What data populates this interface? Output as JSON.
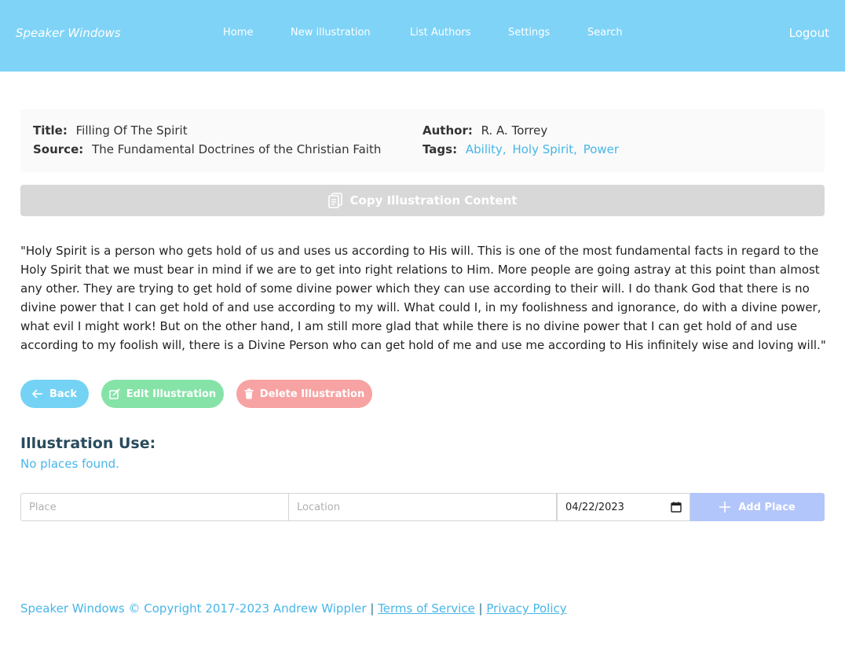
{
  "nav": {
    "brand": "Speaker Windows",
    "links": [
      "Home",
      "New illustration",
      "List Authors",
      "Settings",
      "Search"
    ],
    "logout": "Logout"
  },
  "illustration": {
    "title_label": "Title:",
    "title": "Filling Of The Spirit",
    "source_label": "Source:",
    "source": "The Fundamental Doctrines of the Christian Faith",
    "author_label": "Author:",
    "author": "R. A. Torrey",
    "tags_label": "Tags:",
    "tags": [
      "Ability,",
      "Holy Spirit,",
      "Power"
    ],
    "content": "\"Holy Spirit is a person who gets hold of us and uses us according to His will. This is one of the most fundamental facts in regard to the Holy Spirit that we must bear in mind if we are to get into right relations to Him. More people are going astray at this point than almost any other. They are trying to get hold of some divine power which they can use according to their will. I do thank God that there is no divine power that I can get hold of and use according to my will. What could I, in my foolishness and ignorance, do with a divine power, what evil I might work! But on the other hand, I am still more glad that while there is no divine power that I can get hold of and use according to my foolish will, there is a Divine Person who can get hold of me and use me according to His infinitely wise and loving will.\""
  },
  "actions": {
    "copy": "Copy Illustration Content",
    "back": "Back",
    "edit": "Edit Illustration",
    "delete": "Delete Illustration"
  },
  "use": {
    "title": "Illustration Use:",
    "empty": "No places found.",
    "place_placeholder": "Place",
    "location_placeholder": "Location",
    "date_value": "04/22/2023",
    "add": "Add Place"
  },
  "footer": {
    "text": "Speaker Windows © Copyright 2017-2023 Andrew Wippler",
    "sep": "|",
    "terms": "Terms of Service",
    "privacy": "Privacy Policy"
  },
  "colors": {
    "navbar": "#7fd3f7",
    "accent": "#47b6e8",
    "back": "#74d3f5",
    "edit": "#86e3a8",
    "delete": "#f7a3a3",
    "add": "#b3c6fb"
  }
}
